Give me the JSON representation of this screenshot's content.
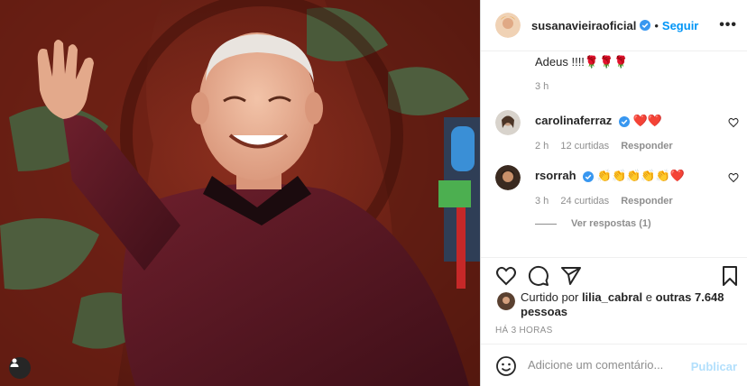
{
  "post": {
    "username": "susanavieiraoficial",
    "follow_label": "Seguir",
    "more_label": "•••",
    "caption_tail": "Adeus !!!!🌹🌹🌹",
    "caption_time": "3 h"
  },
  "comments": [
    {
      "username": "carolinaferraz",
      "text": "❤️❤️",
      "time": "2 h",
      "likes": "12 curtidas",
      "reply": "Responder"
    },
    {
      "username": "rsorrah",
      "text": "👏👏👏👏👏❤️",
      "time": "3 h",
      "likes": "24 curtidas",
      "reply": "Responder"
    }
  ],
  "view_replies": "Ver respostas (1)",
  "likes_line": {
    "prefix": "Curtido por",
    "user": "lilia_cabral",
    "conj": "e",
    "others": "outras 7.648 pessoas"
  },
  "time_ago": "HÁ 3 HORAS",
  "comment_box": {
    "placeholder": "Adicione um comentário...",
    "publish_label": "Publicar"
  },
  "icons": {
    "like": "heart-icon",
    "comment": "comment-icon",
    "share": "paper-plane-icon",
    "save": "bookmark-icon",
    "emoji": "smiley-icon",
    "tag": "user-tag-icon"
  },
  "colors": {
    "accent": "#0095f6",
    "verified": "#3897f0",
    "heart": "#ed4956",
    "muted": "#8e8e8e",
    "publish_disabled": "#b2dffc"
  }
}
